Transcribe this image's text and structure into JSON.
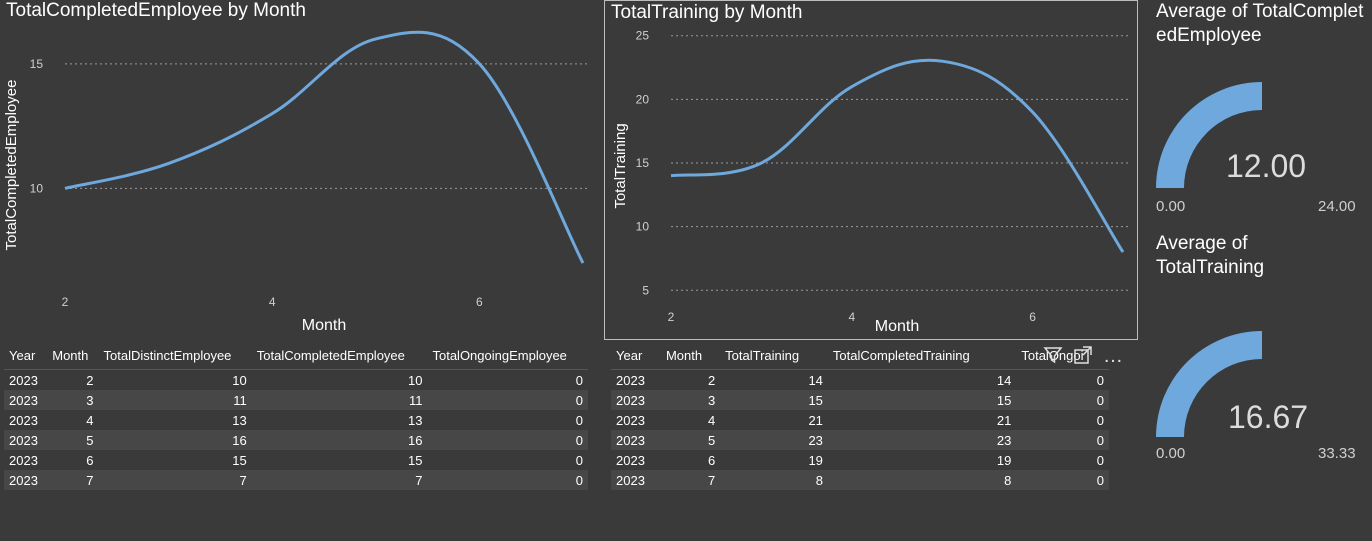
{
  "colors": {
    "line": "#6fa8dc",
    "gauge_fill": "#6fa8dc",
    "gauge_track": "#3a3a3a"
  },
  "chart_data": [
    {
      "type": "line",
      "title": "TotalCompletedEmployee by Month",
      "xlabel": "Month",
      "ylabel": "TotalCompletedEmployee",
      "x": [
        2,
        3,
        4,
        5,
        6,
        7
      ],
      "series": [
        {
          "values": [
            10,
            11,
            13,
            16,
            15,
            7
          ]
        }
      ],
      "xticks": [
        "2",
        "4",
        "6"
      ],
      "yticks": [
        "10",
        "15"
      ],
      "xlim": [
        2,
        7
      ],
      "ylim": [
        6,
        17
      ],
      "grid": true
    },
    {
      "type": "line",
      "title": "TotalTraining by Month",
      "xlabel": "Month",
      "ylabel": "TotalTraining",
      "x": [
        2,
        3,
        4,
        5,
        6,
        7
      ],
      "series": [
        {
          "values": [
            14,
            15,
            21,
            23,
            19,
            8
          ]
        }
      ],
      "xticks": [
        "2",
        "4",
        "6"
      ],
      "yticks": [
        "5",
        "10",
        "15",
        "20",
        "25"
      ],
      "xlim": [
        2,
        7
      ],
      "ylim": [
        4,
        26
      ],
      "grid": true
    }
  ],
  "table1": {
    "headers": [
      "Year",
      "Month",
      "TotalDistinctEmployee",
      "TotalCompletedEmployee",
      "TotalOngoingEmployee"
    ],
    "rows": [
      [
        "2023",
        "2",
        "10",
        "10",
        "0"
      ],
      [
        "2023",
        "3",
        "11",
        "11",
        "0"
      ],
      [
        "2023",
        "4",
        "13",
        "13",
        "0"
      ],
      [
        "2023",
        "5",
        "16",
        "16",
        "0"
      ],
      [
        "2023",
        "6",
        "15",
        "15",
        "0"
      ],
      [
        "2023",
        "7",
        "7",
        "7",
        "0"
      ]
    ]
  },
  "table2": {
    "headers": [
      "Year",
      "Month",
      "TotalTraining",
      "TotalCompletedTraining",
      "TotalOngoi"
    ],
    "rows": [
      [
        "2023",
        "2",
        "14",
        "14",
        "0"
      ],
      [
        "2023",
        "3",
        "15",
        "15",
        "0"
      ],
      [
        "2023",
        "4",
        "21",
        "21",
        "0"
      ],
      [
        "2023",
        "5",
        "23",
        "23",
        "0"
      ],
      [
        "2023",
        "6",
        "19",
        "19",
        "0"
      ],
      [
        "2023",
        "7",
        "8",
        "8",
        "0"
      ]
    ]
  },
  "gauges": [
    {
      "title": "Average of TotalCompletedEmployee",
      "value": "12.00",
      "min": "0.00",
      "max": "24.00",
      "fraction": 0.5
    },
    {
      "title": "Average of TotalTraining",
      "value": "16.67",
      "min": "0.00",
      "max": "33.33",
      "fraction": 0.5
    }
  ],
  "toolbar": {
    "icons": [
      "filter-icon",
      "focus-mode-icon",
      "more-options-icon"
    ],
    "more_glyph": "…"
  }
}
